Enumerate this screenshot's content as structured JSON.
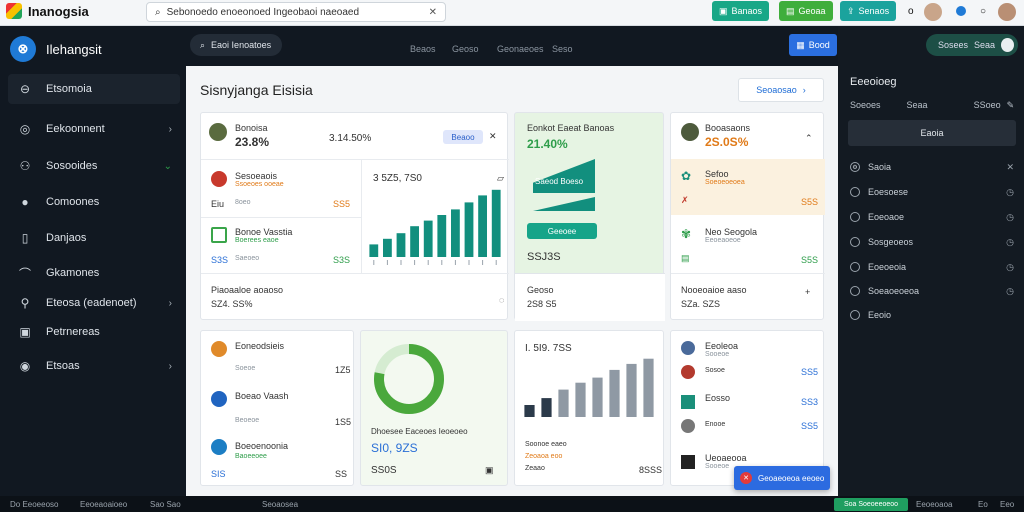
{
  "topbar": {
    "app_title": "Inanogsia",
    "search_value": "Sebonoedo enoeonoed Ingeobaoi naeoaed",
    "btn1": "Banaos",
    "btn2": "Geoaa",
    "btn3": "Senaos",
    "extra": "o"
  },
  "sidebar": {
    "brand": "Ilehangsit",
    "items": [
      {
        "label": "Etsomoia",
        "icon": "⊖"
      },
      {
        "label": "Eekoonnent",
        "icon": "◎"
      },
      {
        "label": "Sosooides",
        "icon": "⚇"
      },
      {
        "label": "Comoones",
        "icon": "●"
      },
      {
        "label": "Danjaos",
        "icon": "▯"
      },
      {
        "label": "Gkamones",
        "icon": "⌒"
      },
      {
        "label": "Eteosa (eadenoet)",
        "icon": "⚲"
      },
      {
        "label": "Petrnereas",
        "icon": "▣"
      },
      {
        "label": "Etsoas",
        "icon": "◉"
      }
    ]
  },
  "header": {
    "workspace": "Eaoi Ienoatoes",
    "tabs": [
      "Beaos",
      "Geoso",
      "Geonaeoes",
      "Seso"
    ],
    "action": "Bood"
  },
  "main": {
    "title": "Sisnyjanga Eisisia",
    "top_button": "Seoaosao",
    "c1": {
      "name": "Bonoisa",
      "pct": "23.8%",
      "value": "3.14.50%",
      "badge": "Beaoo",
      "r1_name": "Sesoeaois",
      "r1_sub": "Ssoeoes ooeae",
      "r1_a": "Eiu",
      "r1_b": "8oeo",
      "r1_c": "SS5",
      "r2_name": "Bonoe Vasstia",
      "r2_sub": "Boerees eaoe",
      "r2_a": "S3S",
      "r2_b": "Saeoeo",
      "r2_c": "S3S",
      "chart_value": "3 5Z5, 7S0",
      "chart_icon": "▱",
      "foot_title": "Piaoaaloe aoaoso",
      "foot_value": "SZ4. SS%"
    },
    "c2": {
      "title": "Eonkot Eaeat Banoas",
      "pct": "21.40%",
      "banner": "Saeod Boeso",
      "sub_btn": "Geeoee",
      "value": "SSJ3S",
      "foot_title": "Geoso",
      "foot_value": "2S8 S5"
    },
    "c3": {
      "name": "Booasaons",
      "pct": "2S.0S%",
      "r1_name": "Sefoo",
      "r1_sub": "Soeoeoeoea",
      "r1_c": "S5S",
      "r2_name": "Neo Seogola",
      "r2_sub": "Eeoeaoeoe",
      "r2_c": "S5S",
      "foot_title": "Nooeoaioe aaso",
      "foot_value": "SZa. SZS"
    },
    "c4": {
      "rows": [
        {
          "name": "Eoneodsieis",
          "sub": "Soeoe",
          "val": "1Z5"
        },
        {
          "name": "Boeao Vaash",
          "sub": "Beoeoe",
          "val": "1S5"
        },
        {
          "name": "Boeoenoonia",
          "sub": "Baoeeoee",
          "val": "S5"
        }
      ],
      "foot_a": "SIS",
      "foot_b": "SS"
    },
    "c5": {
      "caption": "Dhoesee Eaceoes Ieoeoeo",
      "value": "SI0, 9ZS",
      "sub": "SS0S",
      "donut_pct": 0.78
    },
    "c6": {
      "title": "I. 5I9. 7SS",
      "l1": "Soonoe eaeo",
      "l2": "Zeoaoa eoo",
      "l3": "Zeaao",
      "total": "8SSS",
      "bars": [
        14,
        22,
        32,
        40,
        46,
        55,
        62,
        68
      ]
    },
    "c7": {
      "rows": [
        {
          "name": "Eeoleoa",
          "sub": "Sooeoe",
          "val": ""
        },
        {
          "name": "Sosoe",
          "sub": "",
          "val": "SS5"
        },
        {
          "name": "Eosso",
          "sub": "Sooeoe",
          "val": "SS3"
        },
        {
          "name": "Enooe",
          "sub": "",
          "val": "SS5"
        },
        {
          "name": "Ueoaeooa",
          "sub": "Sooeoe",
          "val": ""
        }
      ]
    },
    "toast": "Geoaeoeoa eeoeo"
  },
  "chart_data": {
    "type": "bar",
    "values": [
      18,
      26,
      34,
      44,
      52,
      60,
      68,
      78,
      88,
      96
    ],
    "ylim": [
      0,
      100
    ],
    "categories": [
      "",
      "",
      "",
      "",
      "",
      "",
      "",
      "",
      "",
      ""
    ]
  },
  "right_panel": {
    "toggle_label": "Sosees",
    "toggle_sub": "Seaa",
    "title": "Eeeoioeg",
    "row_a": "Soeoes",
    "row_b": "Seaa",
    "row_c": "SSoeo",
    "button": "Eaoia",
    "items": [
      "Saoia",
      "Eoesoese",
      "Eoeoaoe",
      "Sosgeoeos",
      "Eoeoeoia",
      "Soeaoeoeoa",
      "Eeoio"
    ]
  },
  "statusbar": {
    "a": "Do Eeoeeoso",
    "b": "Eeoeaoaioeo",
    "c": "Sao Sao",
    "d": "Seoaosea",
    "chip": "Soa Soeoeeoeoo",
    "e": "Eeoeoaoa",
    "f": "Eo",
    "g": "Eeo"
  },
  "colors": {
    "accent_green": "#1fae73",
    "accent_teal": "#128f7e",
    "accent_blue": "#2c6be0",
    "sidebar_bg": "#111821"
  }
}
